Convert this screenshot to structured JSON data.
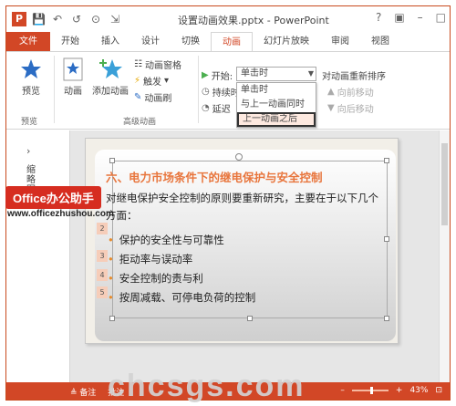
{
  "window": {
    "title": "设置动画效果.pptx - PowerPoint",
    "app_badge": "P",
    "controls": [
      "?",
      "▣",
      "–",
      "□"
    ]
  },
  "qat": {
    "save": "💾",
    "undo": "↶",
    "redo": "↺",
    "start": "⊙",
    "customize": "⇲"
  },
  "tabs": [
    "文件",
    "开始",
    "插入",
    "设计",
    "切换",
    "动画",
    "幻灯片放映",
    "审阅",
    "视图"
  ],
  "active_tab": "动画",
  "ribbon": {
    "preview": "预览",
    "preview_group": "预览",
    "animation": "动画",
    "add_animation": "添加动画",
    "animation_pane": "动画窗格",
    "trigger": "触发",
    "animation_painter": "动画刷",
    "advanced_group": "高级动画",
    "start_label": "开始:",
    "start_value": "单击时",
    "duration_label": "持续时",
    "delay_label": "延迟",
    "reorder": "对动画重新排序",
    "move_earlier": "向前移动",
    "move_later": "向后移动",
    "dropdown_options": [
      "单击时",
      "与上一动画同时",
      "上一动画之后"
    ],
    "dropdown_selected": "上一动画之后"
  },
  "left_pane": {
    "collapse": "›",
    "label": "缩略图"
  },
  "slide": {
    "title": "六、电力市场条件下的继电保护与安全控制",
    "body": "对继电保护安全控制的原则要重新研究，主要在于以下几个方面：",
    "bullets": [
      "保护的安全性与可靠性",
      "拒动率与误动率",
      "安全控制的责与利",
      "按周减载、可停电负荷的控制"
    ],
    "tags": [
      "1",
      "2",
      "3",
      "4",
      "5"
    ]
  },
  "status": {
    "notes": "备注",
    "comments": "批注",
    "zoom": "43%",
    "minus": "–",
    "plus": "+"
  },
  "watermark": {
    "badge": "Office办公助手",
    "url": "www.officezhushou.com",
    "bottom": "chcsgs.com"
  },
  "colors": {
    "accent": "#d24726",
    "title_orange": "#e8753c",
    "bullet": "#e88c2c"
  }
}
